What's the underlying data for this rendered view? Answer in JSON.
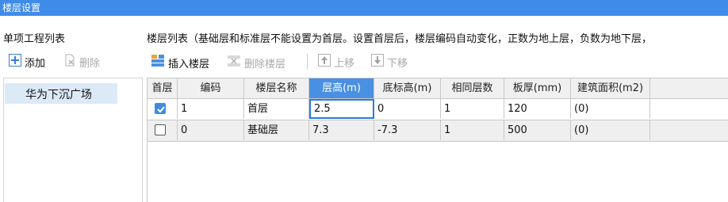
{
  "window": {
    "title": "楼层设置"
  },
  "left_panel": {
    "title": "单项工程列表",
    "add_label": "添加",
    "delete_label": "删除",
    "items": [
      {
        "label": "华为下沉广场",
        "selected": true
      }
    ]
  },
  "right_panel": {
    "title": "楼层列表（基础层和标准层不能设置为首层。设置首层后，楼层编码自动变化，正数为地上层，负数为地下层，",
    "toolbar": {
      "insert_label": "插入楼层",
      "delete_label": "删除楼层",
      "move_up_label": "上移",
      "move_down_label": "下移"
    },
    "table": {
      "headers": [
        "首层",
        "编码",
        "楼层名称",
        "层高(m)",
        "底标高(m)",
        "相同层数",
        "板厚(mm)",
        "建筑面积(m2)"
      ],
      "active_header": "层高(m)",
      "rows": [
        {
          "first": true,
          "code": "1",
          "name": "首层",
          "height": "2.5",
          "bottom": "0",
          "same": "1",
          "thick": "120",
          "area": "(0)"
        },
        {
          "first": false,
          "code": "0",
          "name": "基础层",
          "height": "7.3",
          "bottom": "-7.3",
          "same": "1",
          "thick": "500",
          "area": "(0)"
        }
      ]
    }
  },
  "colors": {
    "titlebar": "#3f8be8",
    "accent": "#4a90e2",
    "selected_row": "#dce9f7"
  }
}
